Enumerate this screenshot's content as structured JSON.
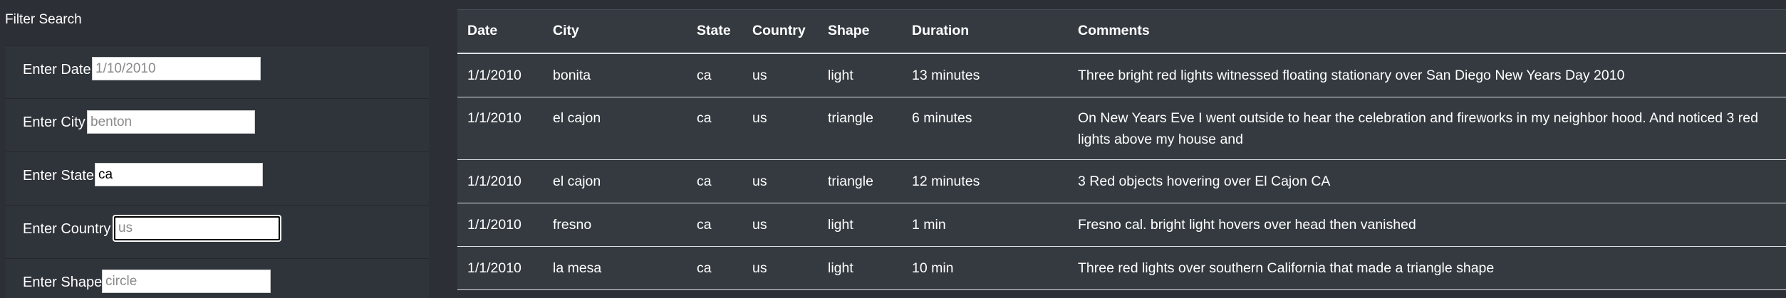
{
  "filter": {
    "title": "Filter Search",
    "fields": [
      {
        "label": "Enter Date",
        "value": "",
        "placeholder": "1/10/2010"
      },
      {
        "label": "Enter City",
        "value": "",
        "placeholder": "benton"
      },
      {
        "label": "Enter State",
        "value": "ca",
        "placeholder": ""
      },
      {
        "label": "Enter Country",
        "value": "",
        "placeholder": "us"
      },
      {
        "label": "Enter Shape",
        "value": "",
        "placeholder": "circle"
      }
    ]
  },
  "table": {
    "headers": [
      "Date",
      "City",
      "State",
      "Country",
      "Shape",
      "Duration",
      "Comments"
    ],
    "rows": [
      [
        "1/1/2010",
        "bonita",
        "ca",
        "us",
        "light",
        "13 minutes",
        "Three bright red lights witnessed floating stationary over San Diego New Years Day 2010"
      ],
      [
        "1/1/2010",
        "el cajon",
        "ca",
        "us",
        "triangle",
        "6 minutes",
        "On New Years Eve I went outside to hear the celebration and fireworks in my neighbor hood. And noticed 3 red lights above my house and"
      ],
      [
        "1/1/2010",
        "el cajon",
        "ca",
        "us",
        "triangle",
        "12 minutes",
        "3 Red objects hovering over El Cajon CA"
      ],
      [
        "1/1/2010",
        "fresno",
        "ca",
        "us",
        "light",
        "1 min",
        "Fresno cal. bright light hovers over head then vanished"
      ],
      [
        "1/1/2010",
        "la mesa",
        "ca",
        "us",
        "light",
        "10 min",
        "Three red lights over southern California that made a triangle shape"
      ]
    ]
  }
}
